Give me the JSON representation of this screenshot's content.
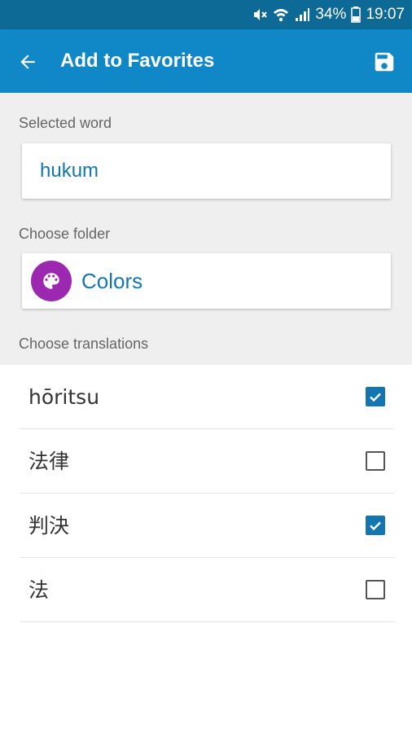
{
  "status_bar": {
    "battery": "34%",
    "time": "19:07",
    "icons": [
      "mute-icon",
      "wifi-icon",
      "signal-icon",
      "battery-icon"
    ]
  },
  "app_bar": {
    "title": "Add to Favorites",
    "back_icon": "arrow-back-icon",
    "save_icon": "save-icon"
  },
  "form": {
    "selected_word_label": "Selected word",
    "selected_word": "hukum",
    "choose_folder_label": "Choose folder",
    "folder": {
      "name": "Colors",
      "icon": "palette-icon",
      "color": "#9c27b0"
    },
    "choose_translations_label": "Choose translations"
  },
  "translations": [
    {
      "text": "hōritsu",
      "checked": true
    },
    {
      "text": "法律",
      "checked": false
    },
    {
      "text": "判決",
      "checked": true
    },
    {
      "text": "法",
      "checked": false
    }
  ],
  "colors": {
    "status_bar": "#0d6a97",
    "app_bar": "#1088c8",
    "accent": "#1476b0",
    "form_background": "#efefef"
  }
}
